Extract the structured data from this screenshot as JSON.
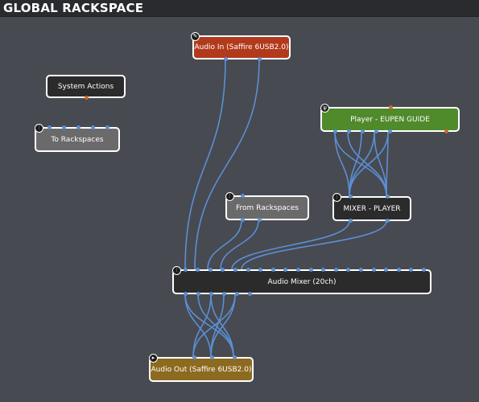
{
  "window": {
    "title": "GLOBAL RACKSPACE"
  },
  "colors": {
    "background": "#474a51",
    "wire": "#5b8fd4",
    "audio_in": "#b23a1c",
    "player": "#4f8a2b",
    "audio_out": "#8c6a20",
    "dark_node": "#2b2b2b",
    "gray_node": "#6a6a6a",
    "pin_orange": "#d06a2a"
  },
  "nodes": {
    "audio_in": {
      "label": "Audio In (Saffire 6USB2.0)",
      "icon": "edit-icon"
    },
    "system_actions": {
      "label": "System Actions"
    },
    "to_rackspaces": {
      "label": "To Rackspaces",
      "icon": "mixer-icon"
    },
    "player": {
      "label": "Player - EUPEN GUIDE",
      "icon": "plugin-icon"
    },
    "from_rackspaces": {
      "label": "From Rackspaces",
      "icon": "mixer-icon"
    },
    "mixer_player": {
      "label": "MIXER - PLAYER",
      "icon": "mixer-icon"
    },
    "audio_mixer": {
      "label": "Audio Mixer (20ch)",
      "icon": "mixer-icon"
    },
    "audio_out": {
      "label": "Audio Out (Saffire 6USB2.0)",
      "icon": "play-icon"
    }
  }
}
